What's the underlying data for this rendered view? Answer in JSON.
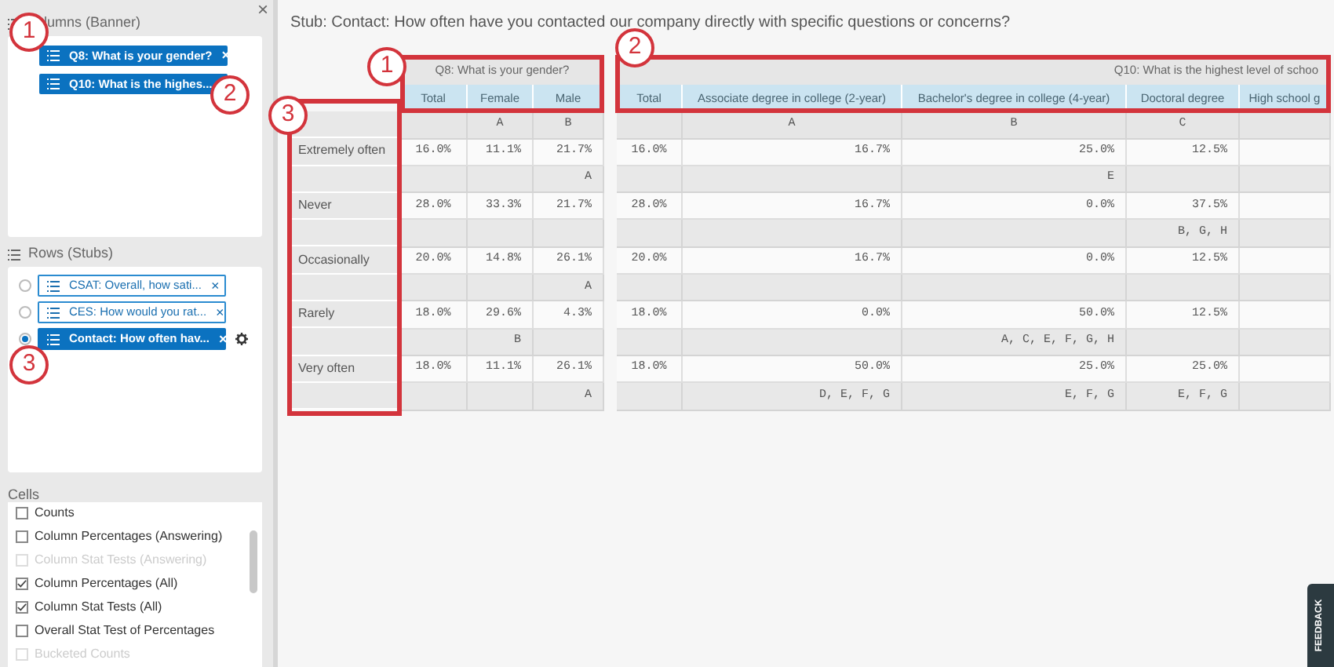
{
  "sidebar": {
    "close": "×",
    "columns": {
      "title": "lumns (Banner)",
      "items": [
        {
          "label": "Q8: What is your gender?",
          "remove": "×"
        },
        {
          "label": "Q10: What is the highes..."
        }
      ]
    },
    "rows": {
      "title": "Rows (Stubs)",
      "items": [
        {
          "label": "CSAT: Overall, how sati...",
          "remove": "×",
          "selected": false
        },
        {
          "label": "CES: How would you rat...",
          "remove": "×",
          "selected": false
        },
        {
          "label": "Contact: How often hav...",
          "remove": "×",
          "selected": true
        }
      ]
    },
    "cells": {
      "title": "Cells",
      "items": [
        {
          "label": "Counts",
          "checked": false,
          "disabled": false
        },
        {
          "label": "Column Percentages (Answering)",
          "checked": false,
          "disabled": false
        },
        {
          "label": "Column Stat Tests (Answering)",
          "checked": false,
          "disabled": true
        },
        {
          "label": "Column Percentages (All)",
          "checked": true,
          "disabled": false
        },
        {
          "label": "Column Stat Tests (All)",
          "checked": true,
          "disabled": false
        },
        {
          "label": "Overall Stat Test of Percentages",
          "checked": false,
          "disabled": false
        },
        {
          "label": "Bucketed Counts",
          "checked": false,
          "disabled": true
        }
      ]
    }
  },
  "title": "Stub: Contact: How often have you contacted our company directly with specific questions or concerns?",
  "banners": [
    {
      "title": "Q8: What is your gender?",
      "columns": [
        {
          "label": "Total"
        },
        {
          "label": "Female",
          "letter": "A"
        },
        {
          "label": "Male",
          "letter": "B"
        }
      ]
    },
    {
      "title": "Q10: What is the highest level of schoo",
      "columns": [
        {
          "label": "Total"
        },
        {
          "label": "Associate degree in college (2-year)",
          "letter": "A"
        },
        {
          "label": "Bachelor's degree in college (4-year)",
          "letter": "B"
        },
        {
          "label": "Doctoral degree",
          "letter": "C"
        },
        {
          "label": "High school g"
        }
      ]
    }
  ],
  "rows": [
    {
      "label": "Extremely often",
      "cells": [
        [
          {
            "value": "16.0%"
          },
          {
            "value": "11.1%"
          },
          {
            "value": "21.7%",
            "sig": "A"
          }
        ],
        [
          {
            "value": "16.0%"
          },
          {
            "value": "16.7%"
          },
          {
            "value": "25.0%",
            "sig": "E"
          },
          {
            "value": "12.5%"
          }
        ]
      ]
    },
    {
      "label": "Never",
      "cells": [
        [
          {
            "value": "28.0%"
          },
          {
            "value": "33.3%"
          },
          {
            "value": "21.7%"
          }
        ],
        [
          {
            "value": "28.0%"
          },
          {
            "value": "16.7%"
          },
          {
            "value": "0.0%"
          },
          {
            "value": "37.5%",
            "sig": "B, G, H"
          }
        ]
      ]
    },
    {
      "label": "Occasionally",
      "cells": [
        [
          {
            "value": "20.0%"
          },
          {
            "value": "14.8%"
          },
          {
            "value": "26.1%",
            "sig": "A"
          }
        ],
        [
          {
            "value": "20.0%"
          },
          {
            "value": "16.7%"
          },
          {
            "value": "0.0%"
          },
          {
            "value": "12.5%"
          }
        ]
      ]
    },
    {
      "label": "Rarely",
      "cells": [
        [
          {
            "value": "18.0%"
          },
          {
            "value": "29.6%",
            "sig": "B"
          },
          {
            "value": "4.3%"
          }
        ],
        [
          {
            "value": "18.0%"
          },
          {
            "value": "0.0%"
          },
          {
            "value": "50.0%",
            "sig": "A, C, E, F, G, H"
          },
          {
            "value": "12.5%"
          }
        ]
      ]
    },
    {
      "label": "Very often",
      "cells": [
        [
          {
            "value": "18.0%"
          },
          {
            "value": "11.1%"
          },
          {
            "value": "26.1%",
            "sig": "A"
          }
        ],
        [
          {
            "value": "18.0%"
          },
          {
            "value": "50.0%",
            "sig": "D, E, F, G"
          },
          {
            "value": "25.0%",
            "sig": "E, F, G"
          },
          {
            "value": "25.0%",
            "sig": "E, F, G"
          }
        ]
      ]
    }
  ],
  "callouts": [
    {
      "label": "1"
    },
    {
      "label": "2"
    },
    {
      "label": "3"
    },
    {
      "label": "1"
    },
    {
      "label": "2"
    },
    {
      "label": "3"
    }
  ],
  "feedback": "FEEDBACK"
}
